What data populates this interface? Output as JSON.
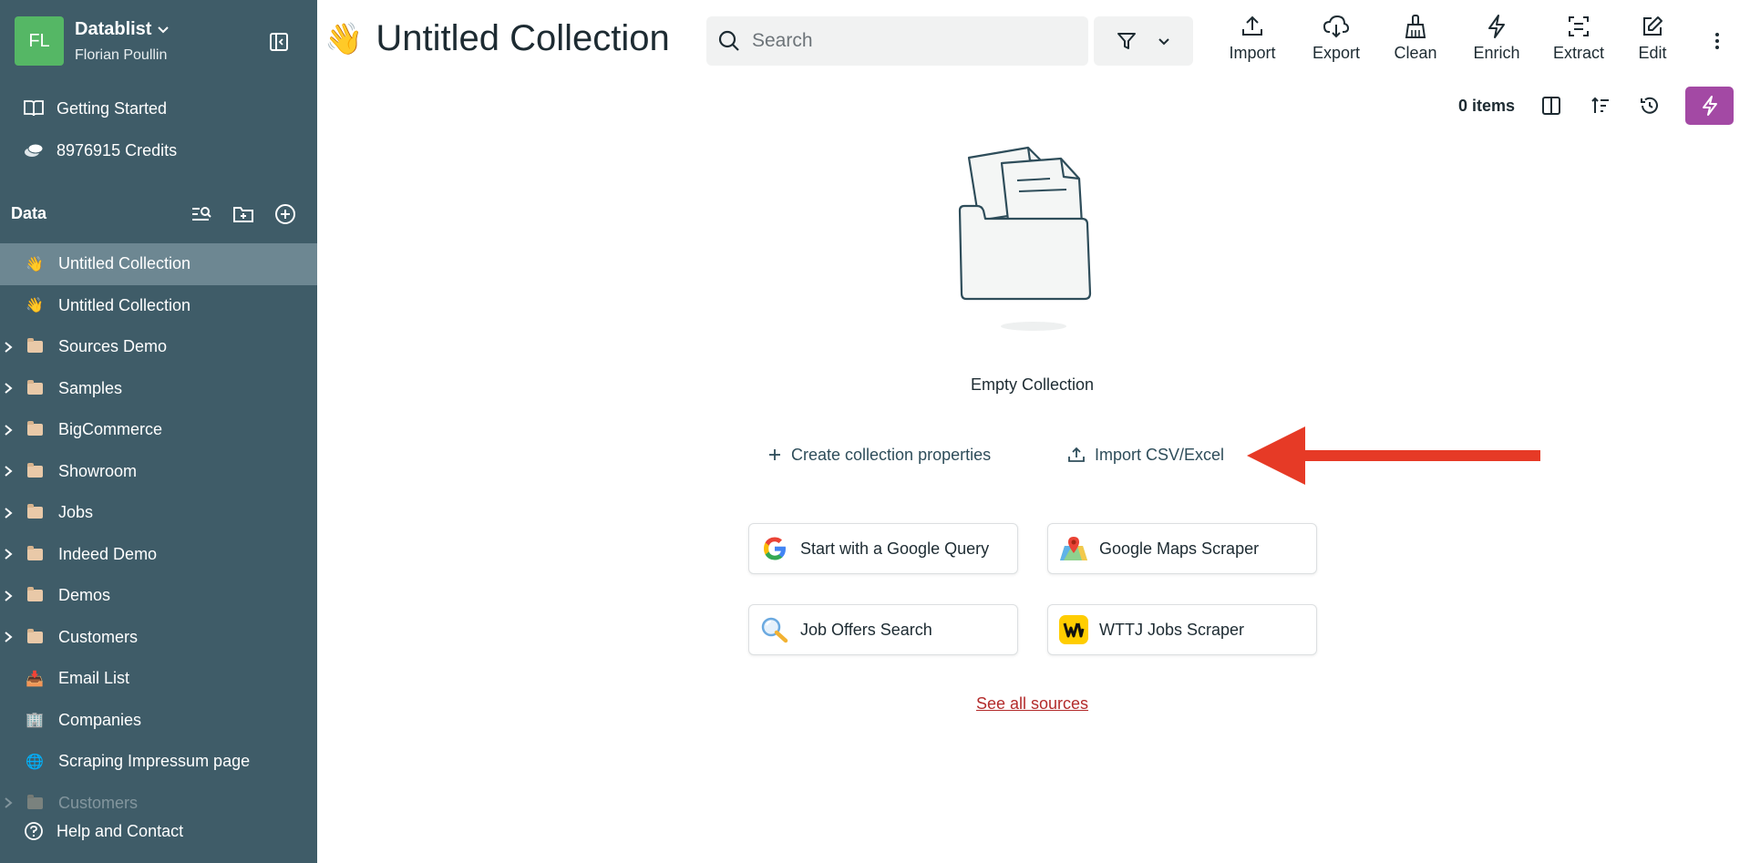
{
  "workspace": {
    "initials": "FL",
    "name": "Datablist",
    "user": "Florian Poullin"
  },
  "top_links": [
    {
      "label": "Getting Started",
      "icon": "book-icon"
    },
    {
      "label": "8976915 Credits",
      "icon": "coins-icon"
    }
  ],
  "data_section": {
    "label": "Data"
  },
  "tree": [
    {
      "label": "Untitled Collection",
      "kind": "collection",
      "emoji": "👋",
      "active": true
    },
    {
      "label": "Untitled Collection",
      "kind": "collection",
      "emoji": "👋"
    },
    {
      "label": "Sources Demo",
      "kind": "folder"
    },
    {
      "label": "Samples",
      "kind": "folder"
    },
    {
      "label": "BigCommerce",
      "kind": "folder"
    },
    {
      "label": "Showroom",
      "kind": "folder"
    },
    {
      "label": "Jobs",
      "kind": "folder"
    },
    {
      "label": "Indeed Demo",
      "kind": "folder"
    },
    {
      "label": "Demos",
      "kind": "folder"
    },
    {
      "label": "Customers",
      "kind": "folder"
    },
    {
      "label": "Email List",
      "kind": "collection",
      "emoji": "📥"
    },
    {
      "label": "Companies",
      "kind": "collection",
      "emoji": "🏢"
    },
    {
      "label": "Scraping Impressum page",
      "kind": "collection",
      "emoji": "🌐"
    },
    {
      "label": "Customers",
      "kind": "folder",
      "faded": true
    }
  ],
  "help": {
    "label": "Help and Contact"
  },
  "header": {
    "emoji": "👋",
    "title": "Untitled Collection",
    "search_placeholder": "Search",
    "tools": [
      {
        "label": "Import",
        "icon": "upload-icon"
      },
      {
        "label": "Export",
        "icon": "cloud-download-icon"
      },
      {
        "label": "Clean",
        "icon": "broom-icon"
      },
      {
        "label": "Enrich",
        "icon": "bolt-icon"
      },
      {
        "label": "Extract",
        "icon": "extract-icon"
      },
      {
        "label": "Edit",
        "icon": "edit-icon"
      }
    ]
  },
  "subbar": {
    "items_count": "0 items"
  },
  "empty_state": {
    "title": "Empty Collection",
    "create_label": "Create collection properties",
    "import_label": "Import CSV/Excel",
    "cards": [
      {
        "label": "Start with a Google Query",
        "icon": "google-icon"
      },
      {
        "label": "Google Maps Scraper",
        "icon": "google-maps-icon"
      },
      {
        "label": "Job Offers Search",
        "icon": "job-search-icon"
      },
      {
        "label": "WTTJ Jobs Scraper",
        "icon": "wttj-icon"
      }
    ],
    "see_all_label": "See all sources"
  },
  "colors": {
    "sidebar": "#3f5c68",
    "active_item": "#6d8792",
    "accent": "#a349a4",
    "arrow": "#e63a26",
    "avatar": "#55b765"
  }
}
